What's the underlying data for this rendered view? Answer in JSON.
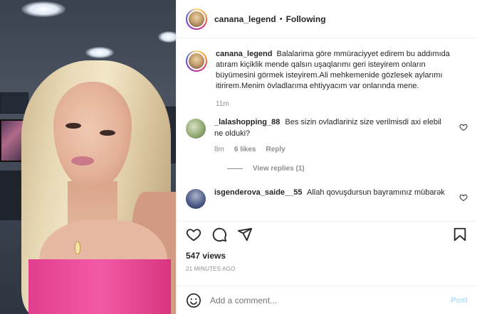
{
  "header": {
    "username": "canana_legend",
    "separator": "•",
    "follow_status": "Following"
  },
  "caption": {
    "username": "canana_legend",
    "text": "Balalarima göre mmüraciyyet edirem bu addımıda atıram kiçiklik mende qalsın uşaqlarımı geri isteyirem onların büyümesini görmek isteyirem.Ali mehkemenide gözlesek aylarımı itirirem.Menim övladlarıma ehtiyyacım var onlarında mene.",
    "time": "11m"
  },
  "comments": [
    {
      "username": "_lalashopping_88",
      "text": "Bes sizin ovladlariniz size verilmisdi axi elebil ne olduki?",
      "time": "8m",
      "likes": "6 likes",
      "reply_label": "Reply",
      "view_replies": "View replies (1)"
    },
    {
      "username": "isgenderova_saide__55",
      "text": "Allah qovuşdursun bayramınız mübarək"
    }
  ],
  "actions": {
    "like_icon": "heart-icon",
    "comment_icon": "comment-icon",
    "share_icon": "share-icon",
    "save_icon": "bookmark-icon"
  },
  "stats": {
    "views": "547 views",
    "time_ago": "21 MINUTES AGO"
  },
  "add_comment": {
    "placeholder": "Add a comment...",
    "post_label": "Post"
  },
  "colors": {
    "text": "#262626",
    "muted": "#8e8e8e",
    "post_disabled": "#b2dffc",
    "accent_pink": "#e23d8f"
  }
}
